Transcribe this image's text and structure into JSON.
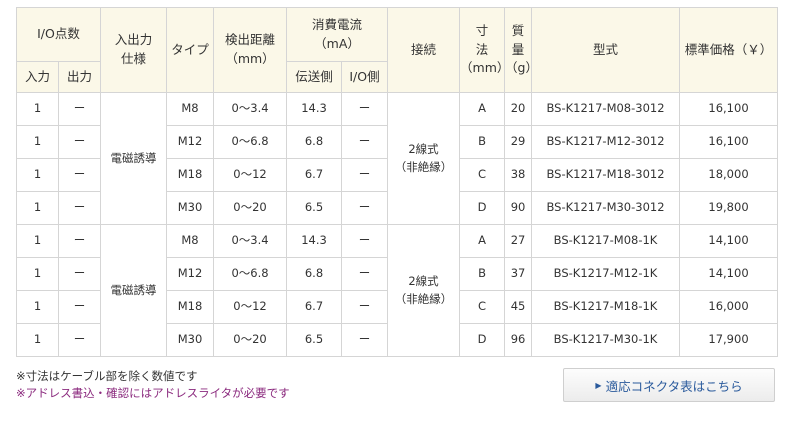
{
  "header": {
    "io_points": "I/O点数",
    "input": "入力",
    "output": "出力",
    "spec": [
      "入出力",
      "仕様"
    ],
    "type": "タイプ",
    "distance": [
      "検出距離",
      "（mm）"
    ],
    "current": [
      "消費電流",
      "（mA）"
    ],
    "transmit": "伝送側",
    "io_side": "I/O側",
    "connection": "接続",
    "dimension": [
      "寸",
      "法",
      "（mm）"
    ],
    "mass": [
      "質",
      "量",
      "（g）"
    ],
    "model": "型式",
    "price": "標準価格（￥）"
  },
  "group1": {
    "spec": "電磁誘導",
    "connection": [
      "2線式",
      "（非絶縁）"
    ],
    "rows": [
      {
        "in": "1",
        "out": "ー",
        "type": "M8",
        "dist": "0〜3.4",
        "tx": "14.3",
        "io": "ー",
        "dim": "A",
        "mass": "20",
        "model": "BS-K1217-M08-3012",
        "price": "16,100"
      },
      {
        "in": "1",
        "out": "ー",
        "type": "M12",
        "dist": "0〜6.8",
        "tx": "6.8",
        "io": "ー",
        "dim": "B",
        "mass": "29",
        "model": "BS-K1217-M12-3012",
        "price": "16,100"
      },
      {
        "in": "1",
        "out": "ー",
        "type": "M18",
        "dist": "0〜12",
        "tx": "6.7",
        "io": "ー",
        "dim": "C",
        "mass": "38",
        "model": "BS-K1217-M18-3012",
        "price": "18,000"
      },
      {
        "in": "1",
        "out": "ー",
        "type": "M30",
        "dist": "0〜20",
        "tx": "6.5",
        "io": "ー",
        "dim": "D",
        "mass": "90",
        "model": "BS-K1217-M30-3012",
        "price": "19,800"
      }
    ]
  },
  "group2": {
    "spec": "電磁誘導",
    "connection": [
      "2線式",
      "（非絶縁）"
    ],
    "rows": [
      {
        "in": "1",
        "out": "ー",
        "type": "M8",
        "dist": "0〜3.4",
        "tx": "14.3",
        "io": "ー",
        "dim": "A",
        "mass": "27",
        "model": "BS-K1217-M08-1K",
        "price": "14,100"
      },
      {
        "in": "1",
        "out": "ー",
        "type": "M12",
        "dist": "0〜6.8",
        "tx": "6.8",
        "io": "ー",
        "dim": "B",
        "mass": "37",
        "model": "BS-K1217-M12-1K",
        "price": "14,100"
      },
      {
        "in": "1",
        "out": "ー",
        "type": "M18",
        "dist": "0〜12",
        "tx": "6.7",
        "io": "ー",
        "dim": "C",
        "mass": "45",
        "model": "BS-K1217-M18-1K",
        "price": "16,000"
      },
      {
        "in": "1",
        "out": "ー",
        "type": "M30",
        "dist": "0〜20",
        "tx": "6.5",
        "io": "ー",
        "dim": "D",
        "mass": "96",
        "model": "BS-K1217-M30-1K",
        "price": "17,900"
      }
    ]
  },
  "notes": {
    "note1": "※寸法はケーブル部を除く数値です",
    "note2": "※アドレス書込・確認にはアドレスライタが必要です"
  },
  "button": {
    "label": "適応コネクタ表はこちら",
    "icon": "triangle-right-icon",
    "text_color": "#2a5a9c"
  },
  "colors": {
    "header_bg": "#fbf8e8",
    "border": "#d5d5d5",
    "note2": "#8b2a7e"
  }
}
